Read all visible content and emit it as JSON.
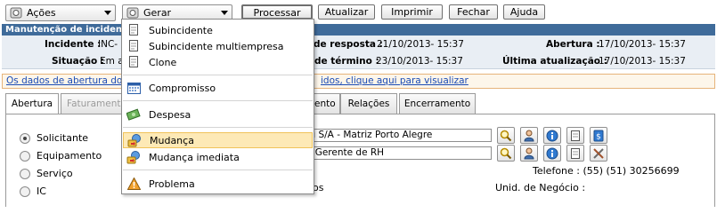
{
  "toolbar": {
    "actions_label": "Ações",
    "generate_label": "Gerar",
    "process_label": "Processar",
    "update_label": "Atualizar",
    "print_label": "Imprimir",
    "close_label": "Fechar",
    "help_label": "Ajuda"
  },
  "header": {
    "title": "Manutenção de incidente",
    "incident_label": "Incidente :",
    "incident_value": "INC-",
    "status_label": "Situação :",
    "status_value": "Em a",
    "response_label": "de resposta :",
    "response_value": "21/10/2013- 15:37",
    "end_label": "de término :",
    "end_value": "23/10/2013- 15:37",
    "opening_label": "Abertura :",
    "opening_value": "17/10/2013- 15:37",
    "last_update_label": "Última atualização :",
    "last_update_value": "17/10/2013- 15:37"
  },
  "notice": {
    "left": "Os dados de abertura do i",
    "right": "idos, clique aqui para visualizar"
  },
  "tabs": [
    {
      "label": "Abertura"
    },
    {
      "label": "Faturamento"
    },
    {
      "label": "ento"
    },
    {
      "label": "Relações"
    },
    {
      "label": "Encerramento"
    }
  ],
  "form": {
    "radio_requester": "Solicitante",
    "radio_equipment": "Equipamento",
    "radio_service": "Serviço",
    "radio_ic": "IC",
    "field1_value": "mi S/A - Matriz Porto Alegre",
    "field2_value": "la Gerente de RH",
    "phone_text": "Telefone : (55) (51) 30256699",
    "business_unit_text": "Unid. de Negócio :",
    "partial_text": "os"
  },
  "menu": {
    "items": [
      {
        "label": "Subincidente",
        "icon": "document-icon"
      },
      {
        "label": "Subincidente multiempresa",
        "icon": "document-icon"
      },
      {
        "label": "Clone",
        "icon": "document-icon"
      },
      {
        "label": "Compromisso",
        "icon": "calendar-icon"
      },
      {
        "label": "Despesa",
        "icon": "money-icon"
      },
      {
        "label": "Mudança",
        "icon": "change-icon"
      },
      {
        "label": "Mudança imediata",
        "icon": "change-icon"
      },
      {
        "label": "Problema",
        "icon": "warning-icon"
      }
    ],
    "highlighted": "Mudança"
  },
  "colors": {
    "header_bar": "#3f6b9a",
    "header_body": "#e9eef4",
    "menu_highlight": "#fde9b6",
    "link": "#1a4bb5"
  }
}
